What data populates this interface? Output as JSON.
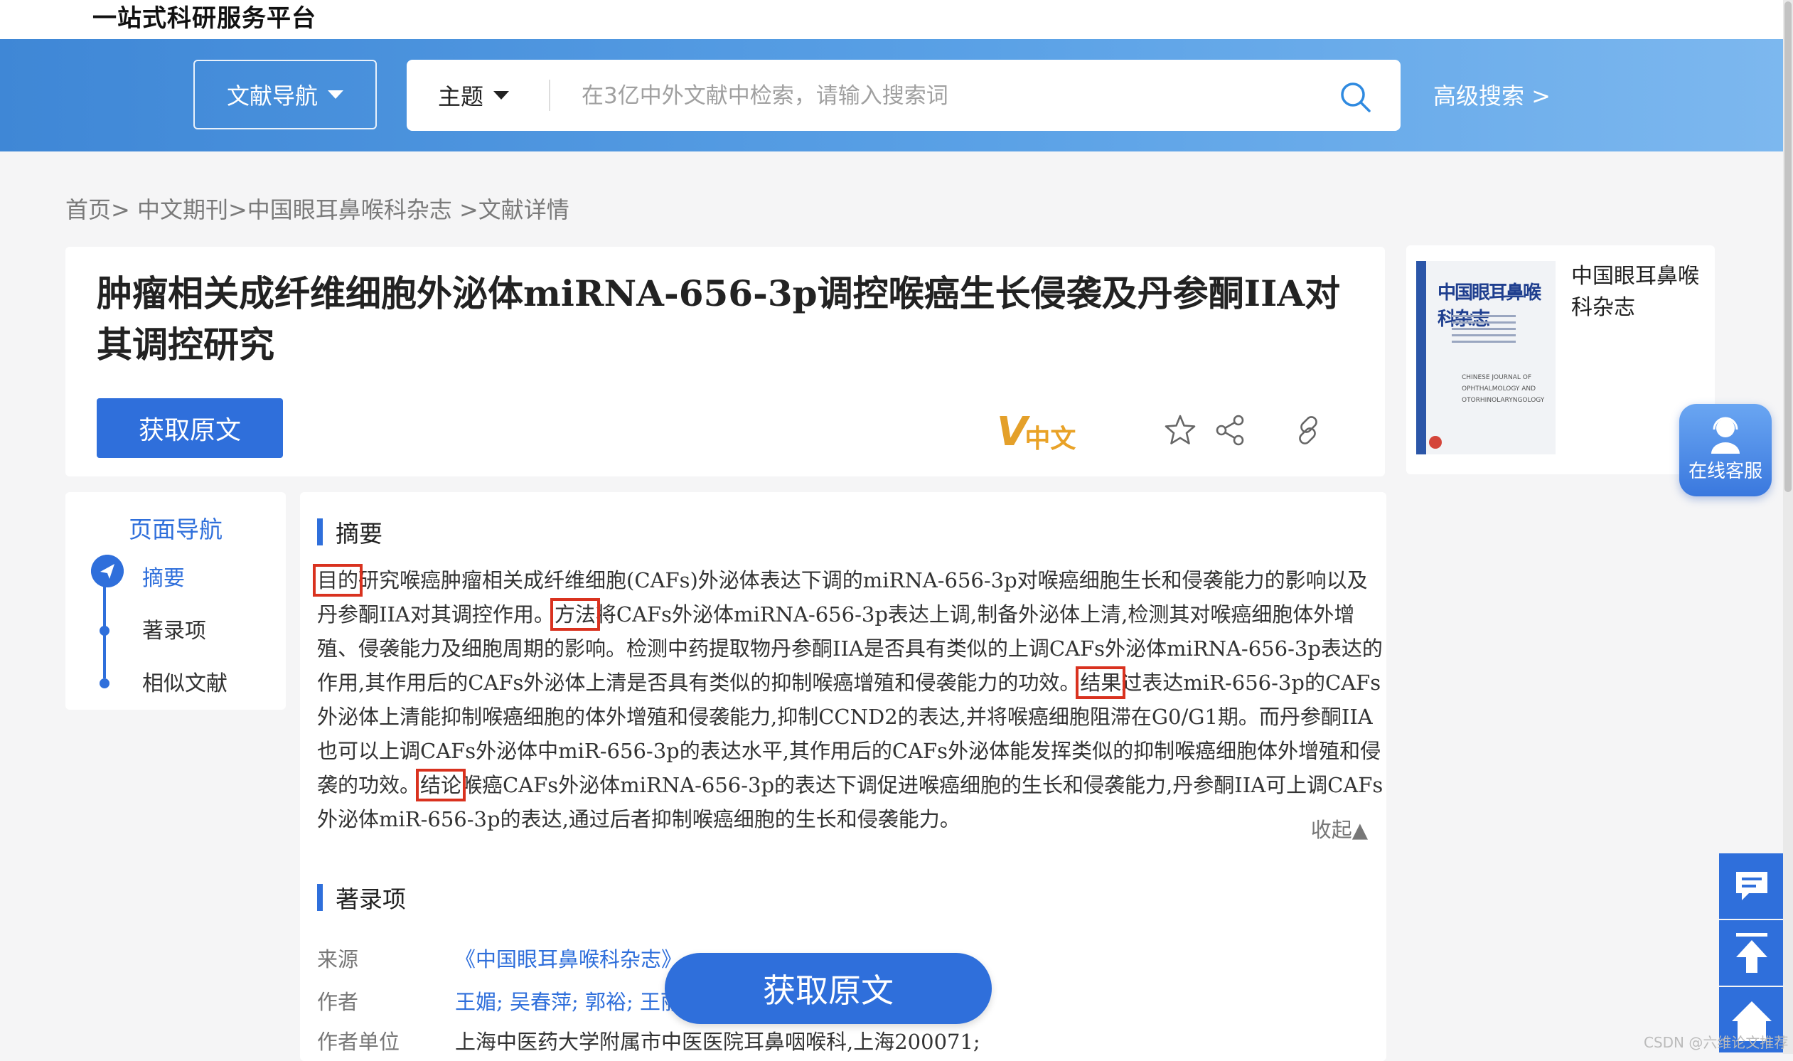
{
  "brand": "一站式科研服务平台",
  "search": {
    "nav_label": "文献导航",
    "scope_label": "主题",
    "placeholder": "在3亿中外文献中检索，请输入搜索词",
    "advanced": "高级搜索 >"
  },
  "breadcrumb": "首页> 中文期刊>中国眼耳鼻喉科杂志 >文献详情",
  "article": {
    "title": "肿瘤相关成纤维细胞外泌体miRNA-656-3p调控喉癌生长侵袭及丹参酮IIA对其调控研究",
    "get_button": "获取原文",
    "source_badge": "中文"
  },
  "journal": {
    "name": "中国眼耳鼻喉科杂志",
    "cover_title": "中国眼耳鼻喉科杂志",
    "cover_en": "CHINESE JOURNAL OF OPHTHALMOLOGY AND OTORHINOLARYNGOLOGY"
  },
  "side_nav": {
    "title": "页面导航",
    "items": [
      "摘要",
      "著录项",
      "相似文献"
    ]
  },
  "abstract": {
    "heading": "摘要",
    "p1": "目的",
    "t1": "研究喉癌肿瘤相关成纤维细胞(CAFs)外泌体表达下调的miRNA-656-3p对喉癌细胞生长和侵袭能力的影响以及丹参酮IIA对其调控作用。",
    "p2": "方法",
    "t2": "将CAFs外泌体miRNA-656-3p表达上调,制备外泌体上清,检测其对喉癌细胞体外增殖、侵袭能力及细胞周期的影响。检测中药提取物丹参酮IIA是否具有类似的上调CAFs外泌体miRNA-656-3p表达的作用,其作用后的CAFs外泌体上清是否具有类似的抑制喉癌增殖和侵袭能力的功效。",
    "p3": "结果",
    "t3": "过表达miR-656-3p的CAFs外泌体上清能抑制喉癌细胞的体外增殖和侵袭能力,抑制CCND2的表达,并将喉癌细胞阻滞在G0/G1期。而丹参酮IIA也可以上调CAFs外泌体中miR-656-3p的表达水平,其作用后的CAFs外泌体能发挥类似的抑制喉癌细胞体外增殖和侵袭的功效。",
    "p4": "结论",
    "t4": "喉癌CAFs外泌体miRNA-656-3p的表达下调促进喉癌细胞的生长和侵袭能力,丹参酮IIA可上调CAFs外泌体miR-656-3p的表达,通过后者抑制喉癌细胞的生长和侵袭能力。",
    "collapse": "收起▲"
  },
  "bibliography": {
    "heading": "著录项",
    "source_label": "来源",
    "source_value": "《中国眼耳鼻喉科杂志》",
    "author_label": "作者",
    "author_value": "王媚; 吴春萍; 郭裕; 王丽",
    "affil_label": "作者单位",
    "affil_value": "上海中医药大学附属市中医医院耳鼻咽喉科,上海200071;"
  },
  "floating": {
    "get_button": "获取原文",
    "service": "在线客服"
  },
  "watermark": "CSDN @六维论文推荐",
  "colors": {
    "accent": "#2f6fdb",
    "highlight_box": "#d9321f",
    "badge": "#e9a227"
  }
}
